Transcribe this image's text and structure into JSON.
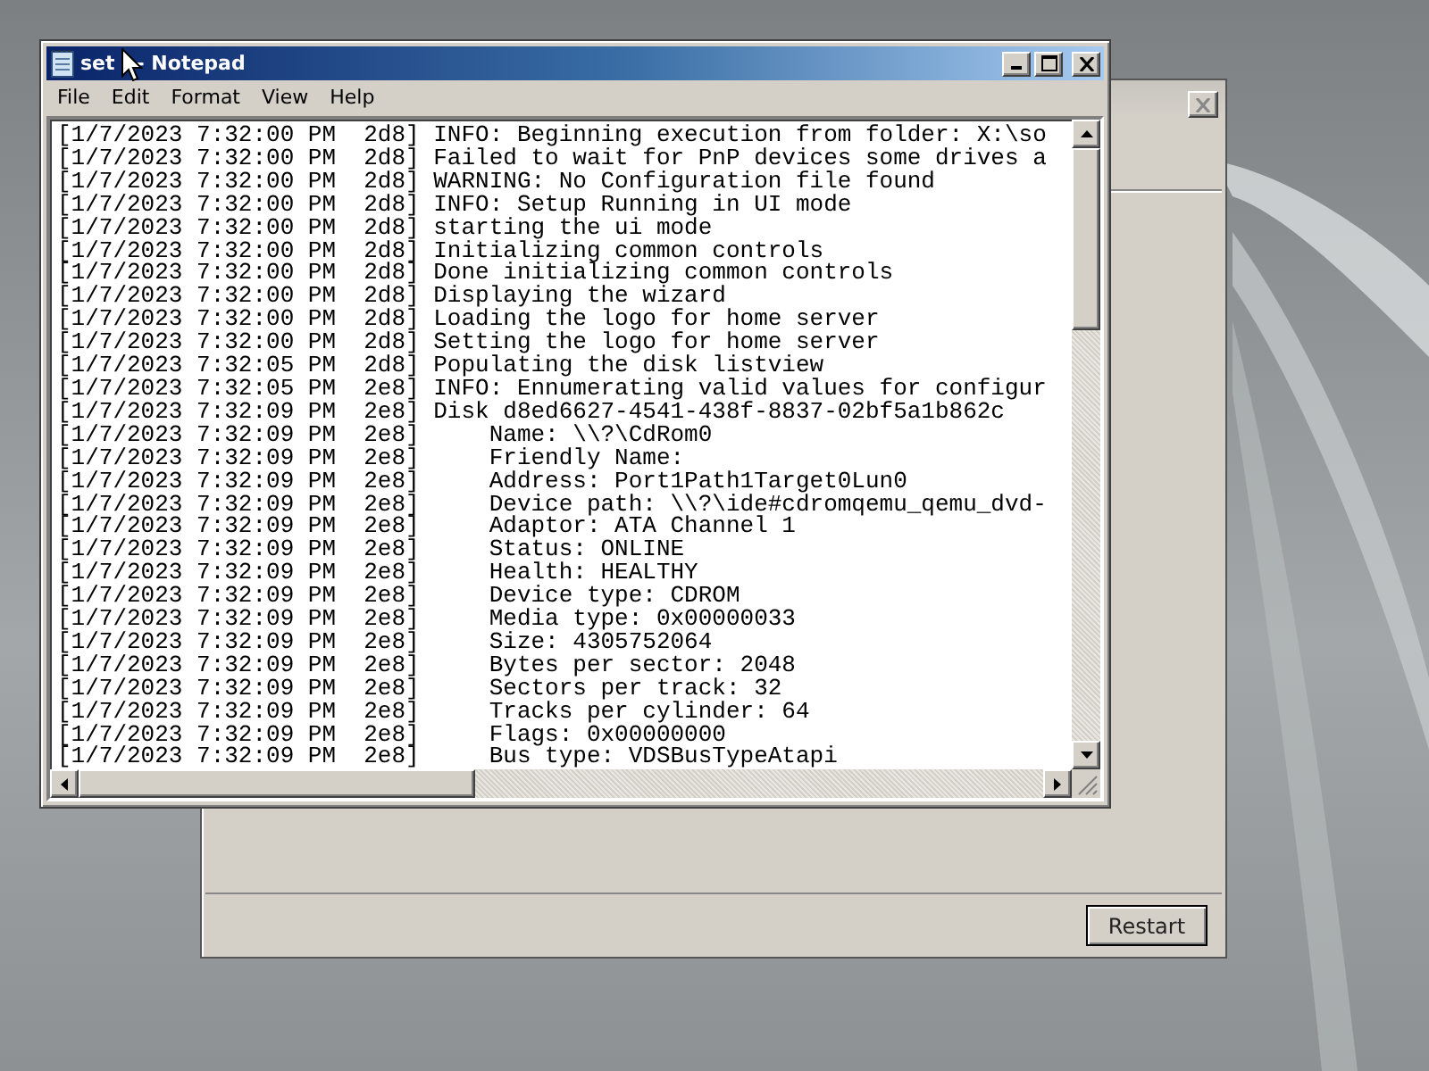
{
  "background_dialog": {
    "buttons": [
      {
        "label": "Restart"
      }
    ]
  },
  "notepad": {
    "title_parts": [
      "set",
      "- Notepad"
    ],
    "menu": [
      "File",
      "Edit",
      "Format",
      "View",
      "Help"
    ],
    "lines": [
      "[1/7/2023 7:32:00 PM  2d8] INFO: Beginning execution from folder: X:\\so",
      "[1/7/2023 7:32:00 PM  2d8] Failed to wait for PnP devices some drives a",
      "[1/7/2023 7:32:00 PM  2d8] WARNING: No Configuration file found",
      "[1/7/2023 7:32:00 PM  2d8] INFO: Setup Running in UI mode",
      "[1/7/2023 7:32:00 PM  2d8] starting the ui mode",
      "[1/7/2023 7:32:00 PM  2d8] Initializing common controls",
      "[1/7/2023 7:32:00 PM  2d8] Done initializing common controls",
      "[1/7/2023 7:32:00 PM  2d8] Displaying the wizard",
      "[1/7/2023 7:32:00 PM  2d8] Loading the logo for home server",
      "[1/7/2023 7:32:00 PM  2d8] Setting the logo for home server",
      "[1/7/2023 7:32:05 PM  2d8] Populating the disk listview",
      "[1/7/2023 7:32:05 PM  2e8] INFO: Ennumerating valid values for configur",
      "[1/7/2023 7:32:09 PM  2e8] Disk d8ed6627-4541-438f-8837-02bf5a1b862c",
      "[1/7/2023 7:32:09 PM  2e8]     Name: \\\\?\\CdRom0",
      "[1/7/2023 7:32:09 PM  2e8]     Friendly Name:",
      "[1/7/2023 7:32:09 PM  2e8]     Address: Port1Path1Target0Lun0",
      "[1/7/2023 7:32:09 PM  2e8]     Device path: \\\\?\\ide#cdromqemu_qemu_dvd-",
      "[1/7/2023 7:32:09 PM  2e8]     Adaptor: ATA Channel 1",
      "[1/7/2023 7:32:09 PM  2e8]     Status: ONLINE",
      "[1/7/2023 7:32:09 PM  2e8]     Health: HEALTHY",
      "[1/7/2023 7:32:09 PM  2e8]     Device type: CDROM",
      "[1/7/2023 7:32:09 PM  2e8]     Media type: 0x00000033",
      "[1/7/2023 7:32:09 PM  2e8]     Size: 4305752064",
      "[1/7/2023 7:32:09 PM  2e8]     Bytes per sector: 2048",
      "[1/7/2023 7:32:09 PM  2e8]     Sectors per track: 32",
      "[1/7/2023 7:32:09 PM  2e8]     Tracks per cylinder: 64",
      "[1/7/2023 7:32:09 PM  2e8]     Flags: 0x00000000",
      "[1/7/2023 7:32:09 PM  2e8]     Bus type: VDSBusTypeAtapi"
    ]
  }
}
